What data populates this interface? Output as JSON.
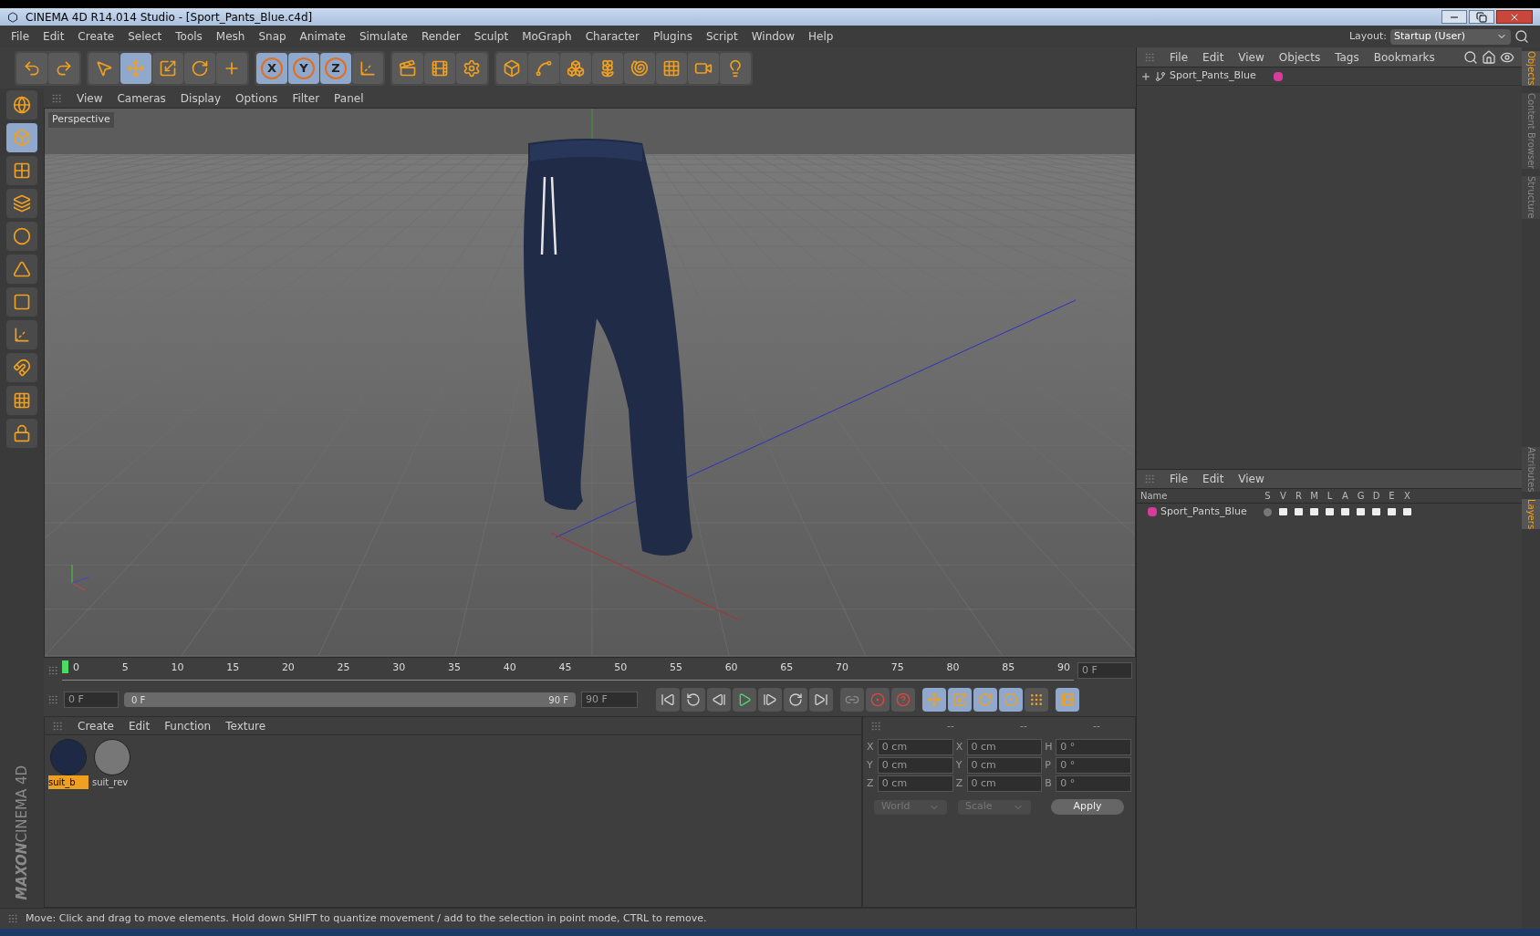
{
  "window": {
    "title": "CINEMA 4D R14.014 Studio - [Sport_Pants_Blue.c4d]"
  },
  "menu_bar": [
    "File",
    "Edit",
    "Create",
    "Select",
    "Tools",
    "Mesh",
    "Snap",
    "Animate",
    "Simulate",
    "Render",
    "Sculpt",
    "MoGraph",
    "Character",
    "Plugins",
    "Script",
    "Window",
    "Help"
  ],
  "layout": {
    "label": "Layout:",
    "value": "Startup (User)"
  },
  "toolbar": [
    [
      {
        "kind": "undo",
        "selected": false
      },
      {
        "kind": "redo",
        "selected": false
      }
    ],
    [
      {
        "kind": "select",
        "selected": false
      },
      {
        "kind": "move",
        "selected": true
      },
      {
        "kind": "scale",
        "selected": false
      },
      {
        "kind": "rotate",
        "selected": false
      },
      {
        "kind": "add",
        "selected": false
      }
    ],
    [
      {
        "kind": "axis",
        "label": "X",
        "selected": true
      },
      {
        "kind": "axis",
        "label": "Y",
        "selected": true
      },
      {
        "kind": "axis",
        "label": "Z",
        "selected": true
      },
      {
        "kind": "coords",
        "selected": false
      }
    ],
    [
      {
        "kind": "render-view",
        "selected": false
      },
      {
        "kind": "render",
        "selected": false
      },
      {
        "kind": "render-settings",
        "selected": false
      }
    ],
    [
      {
        "kind": "cube",
        "selected": false
      },
      {
        "kind": "spline",
        "selected": false
      },
      {
        "kind": "subdivision",
        "selected": false
      },
      {
        "kind": "cloner",
        "selected": false
      },
      {
        "kind": "deformer",
        "selected": false
      },
      {
        "kind": "floor",
        "selected": false
      },
      {
        "kind": "camera",
        "selected": false
      },
      {
        "kind": "light",
        "selected": false
      }
    ]
  ],
  "left_tools": [
    {
      "kind": "camera",
      "selected": false
    },
    {
      "kind": "model",
      "selected": true
    },
    {
      "kind": "texture",
      "selected": false
    },
    {
      "kind": "workplane",
      "selected": false
    },
    {
      "kind": "points",
      "selected": false
    },
    {
      "kind": "edges",
      "selected": false
    },
    {
      "kind": "polygons",
      "selected": false
    },
    {
      "kind": "axis",
      "selected": false
    },
    {
      "kind": "magnet",
      "selected": false
    },
    {
      "kind": "grid",
      "selected": false
    },
    {
      "kind": "lock",
      "selected": false
    }
  ],
  "viewport": {
    "menu": [
      "View",
      "Cameras",
      "Display",
      "Options",
      "Filter",
      "Panel"
    ],
    "label": "Perspective"
  },
  "timeline": {
    "ticks": [
      "0",
      "5",
      "10",
      "15",
      "20",
      "25",
      "30",
      "35",
      "40",
      "45",
      "50",
      "55",
      "60",
      "65",
      "70",
      "75",
      "80",
      "85",
      "90"
    ],
    "level": 0,
    "current": "0 F"
  },
  "transport": {
    "start": "0 F",
    "range_start": "0 F",
    "range_end": "90 F",
    "end": "90 F",
    "buttons": [
      {
        "kind": "first",
        "selected": false
      },
      {
        "kind": "prev-key",
        "selected": false
      },
      {
        "kind": "prev-frame",
        "selected": false
      },
      {
        "kind": "play",
        "selected": false
      },
      {
        "kind": "next-frame",
        "selected": false
      },
      {
        "kind": "next-key",
        "selected": false
      },
      {
        "kind": "last",
        "selected": false
      },
      {
        "kind": "keylink",
        "selected": false
      },
      {
        "kind": "record",
        "selected": false
      },
      {
        "kind": "autokey",
        "selected": false
      },
      {
        "kind": "pos",
        "selected": true
      },
      {
        "kind": "scale",
        "selected": true
      },
      {
        "kind": "rot",
        "selected": true
      },
      {
        "kind": "param",
        "selected": true
      },
      {
        "kind": "pla",
        "selected": false
      },
      {
        "kind": "timeline",
        "selected": true
      }
    ]
  },
  "materials": {
    "menu": [
      "Create",
      "Edit",
      "Function",
      "Texture"
    ],
    "items": [
      {
        "name": "suit_b",
        "selected": true
      },
      {
        "name": "suit_rev",
        "selected": false
      }
    ]
  },
  "coordinates": {
    "headers": [
      "--",
      "--",
      "--"
    ],
    "rows": [
      [
        "X",
        "0 cm",
        "X",
        "0 cm",
        "H",
        "0 °"
      ],
      [
        "Y",
        "0 cm",
        "Y",
        "0 cm",
        "P",
        "0 °"
      ],
      [
        "Z",
        "0 cm",
        "Z",
        "0 cm",
        "B",
        "0 °"
      ]
    ],
    "dropdowns": [
      {
        "value": "World",
        "disabled": true
      },
      {
        "value": "Scale",
        "disabled": true
      }
    ],
    "apply": "Apply"
  },
  "objects_panel": {
    "menu": [
      "File",
      "Edit",
      "View",
      "Objects",
      "Tags",
      "Bookmarks"
    ],
    "items": [
      {
        "name": "Sport_Pants_Blue",
        "color": "#d63c9c"
      }
    ]
  },
  "layers_panel": {
    "menu": [
      "File",
      "Edit",
      "View"
    ],
    "columns": [
      "Name",
      "S",
      "V",
      "R",
      "M",
      "L",
      "A",
      "G",
      "D",
      "E",
      "X"
    ],
    "items": [
      {
        "name": "Sport_Pants_Blue",
        "color": "#d63c9c",
        "flags": [
          false,
          true,
          true,
          true,
          true,
          true,
          true,
          true,
          true,
          true
        ]
      }
    ]
  },
  "side_tabs": [
    [
      {
        "label": "Objects",
        "selected": true
      },
      {
        "label": "Content Browser",
        "selected": false
      },
      {
        "label": "Structure",
        "selected": false
      }
    ],
    [
      {
        "label": "Attributes",
        "selected": false
      },
      {
        "label": "Layers",
        "selected": true
      }
    ]
  ],
  "logo": [
    "MAXON",
    "CINEMA 4D"
  ],
  "status_bar": "Move: Click and drag to move elements. Hold down SHIFT to quantize movement / add to the selection in point mode, CTRL to remove."
}
